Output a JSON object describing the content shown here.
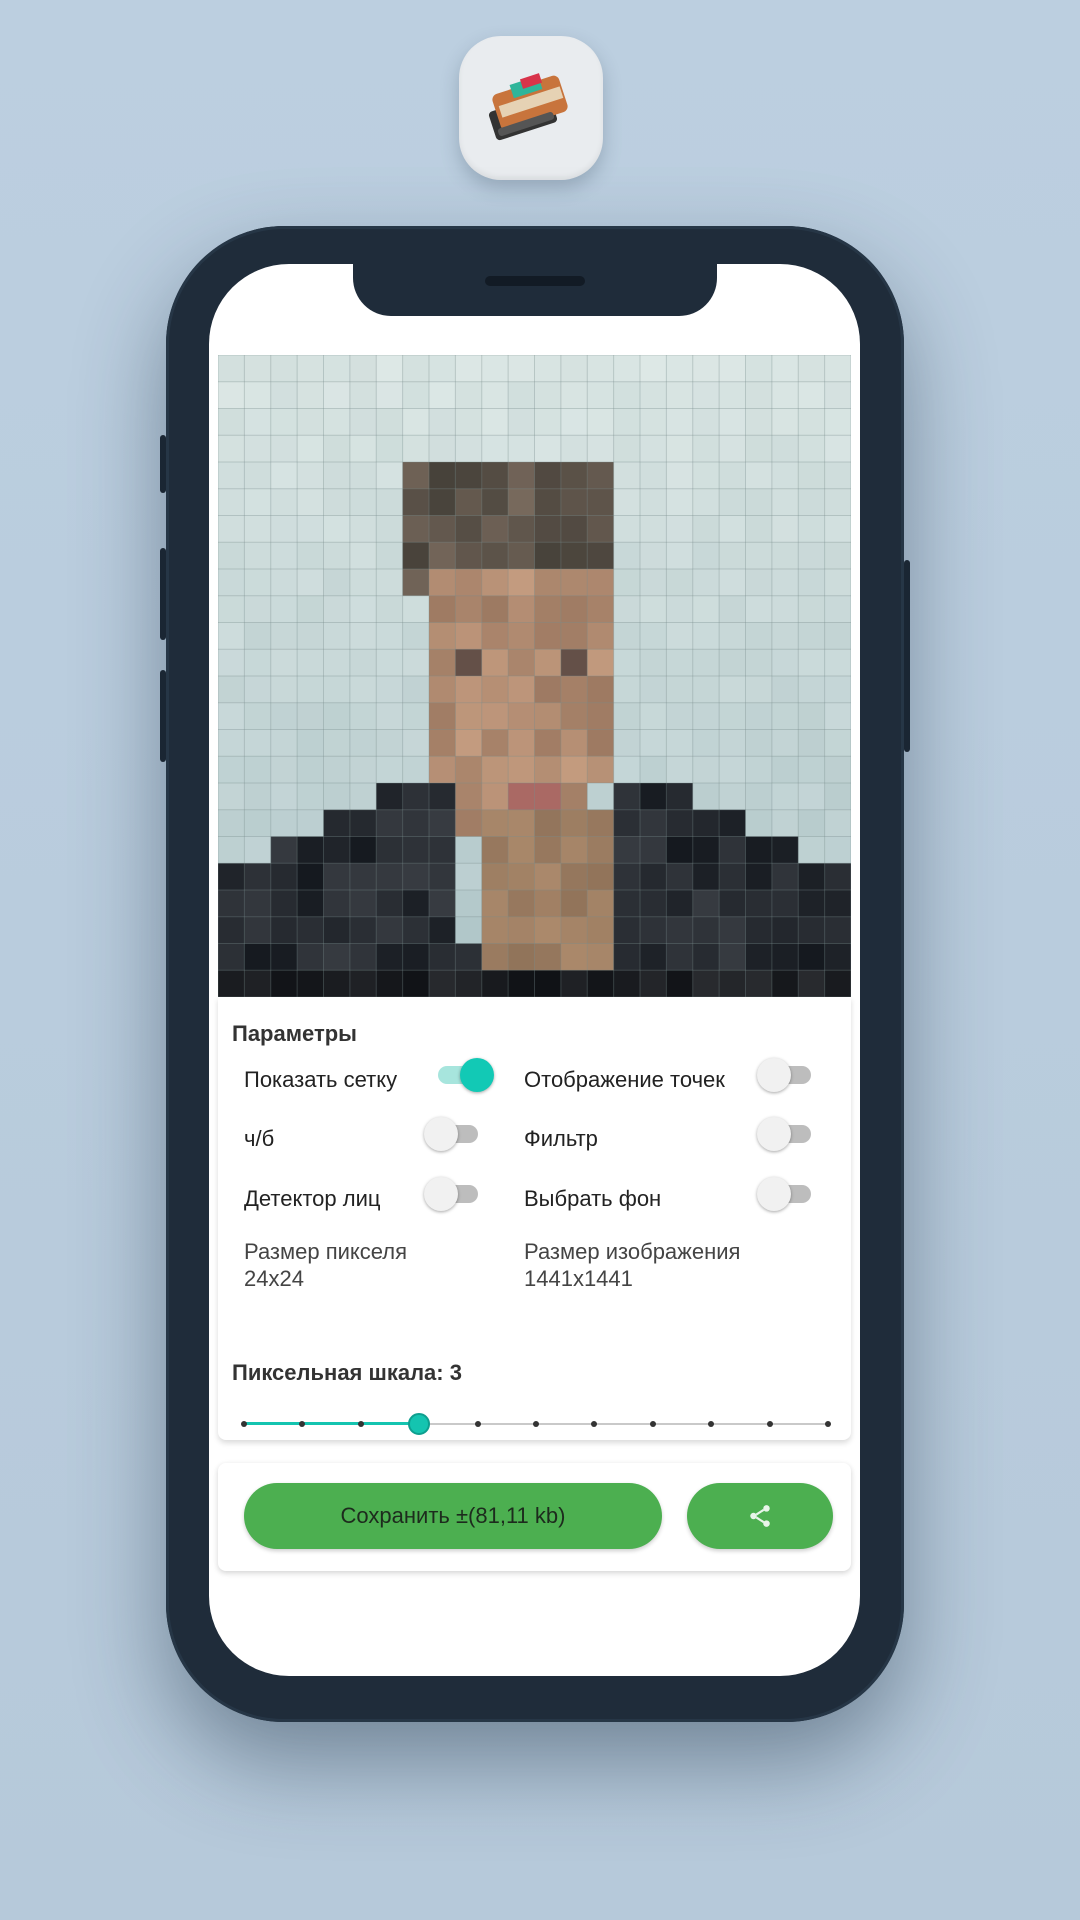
{
  "app_icon": {
    "name": "book-icon"
  },
  "params": {
    "title": "Параметры",
    "options": [
      {
        "label": "Показать сетку",
        "on": true
      },
      {
        "label": "Отображение точек",
        "on": false
      },
      {
        "label": "ч/б",
        "on": false
      },
      {
        "label": "Фильтр",
        "on": false
      },
      {
        "label": "Детектор лиц",
        "on": false
      },
      {
        "label": "Выбрать фон",
        "on": false
      }
    ],
    "pixel_size_label": "Размер пикселя",
    "pixel_size_value": "24x24",
    "image_size_label": "Размер изображения",
    "image_size_value": "1441x1441"
  },
  "scale": {
    "label": "Пиксельная шкала: 3",
    "value": 3,
    "min": 0,
    "max": 10
  },
  "actions": {
    "save_label": "Сохранить ±(81,11 kb)",
    "share_icon": "share-icon"
  },
  "colors": {
    "accent": "#12c9b5",
    "button": "#4caf50",
    "phone": "#1f2c3a"
  }
}
